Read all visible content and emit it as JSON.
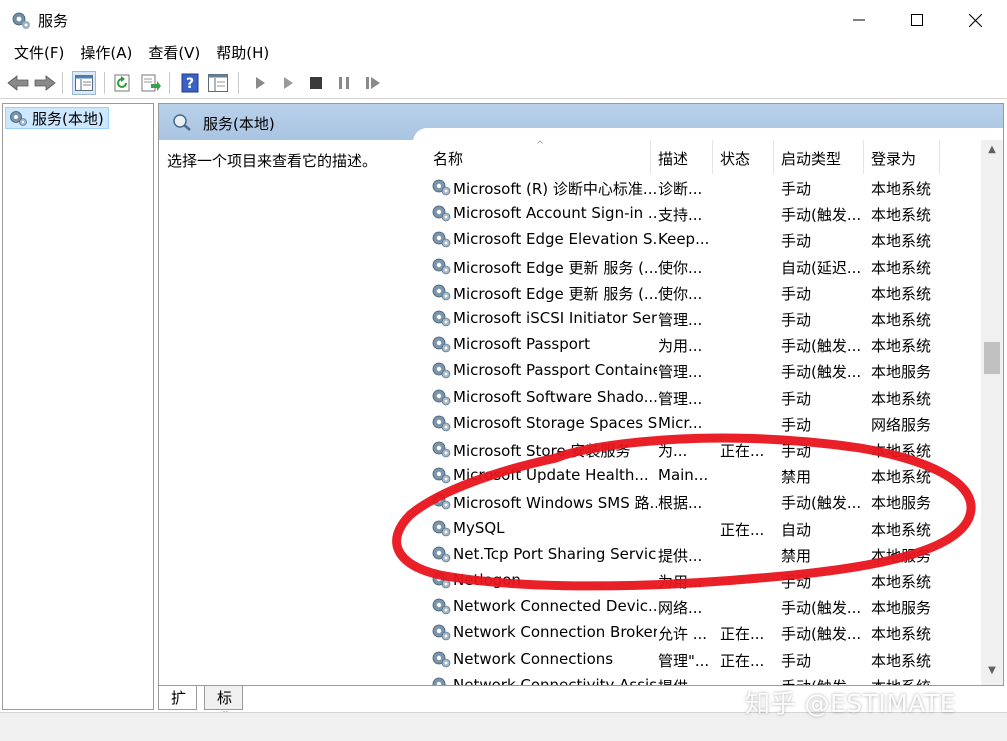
{
  "window": {
    "title": "服务"
  },
  "menu": [
    {
      "label": "文件(F)"
    },
    {
      "label": "操作(A)"
    },
    {
      "label": "查看(V)"
    },
    {
      "label": "帮助(H)"
    }
  ],
  "tree": {
    "root_label": "服务(本地)"
  },
  "pane": {
    "header_title": "服务(本地)",
    "description_hint": "选择一个项目来查看它的描述。"
  },
  "columns": {
    "name": "名称",
    "description": "描述",
    "status": "状态",
    "startup": "启动类型",
    "logon": "登录为"
  },
  "services": [
    {
      "name": "Microsoft (R) 诊断中心标准...",
      "description": "诊断...",
      "status": "",
      "startup": "手动",
      "logon": "本地系统"
    },
    {
      "name": "Microsoft Account Sign-in ...",
      "description": "支持...",
      "status": "",
      "startup": "手动(触发...",
      "logon": "本地系统"
    },
    {
      "name": "Microsoft Edge Elevation S...",
      "description": "Keep...",
      "status": "",
      "startup": "手动",
      "logon": "本地系统"
    },
    {
      "name": "Microsoft Edge 更新 服务 (...",
      "description": "使你...",
      "status": "",
      "startup": "自动(延迟...",
      "logon": "本地系统"
    },
    {
      "name": "Microsoft Edge 更新 服务 (...",
      "description": "使你...",
      "status": "",
      "startup": "手动",
      "logon": "本地系统"
    },
    {
      "name": "Microsoft iSCSI Initiator Ser...",
      "description": "管理...",
      "status": "",
      "startup": "手动",
      "logon": "本地系统"
    },
    {
      "name": "Microsoft Passport",
      "description": "为用...",
      "status": "",
      "startup": "手动(触发...",
      "logon": "本地系统"
    },
    {
      "name": "Microsoft Passport Container",
      "description": "管理...",
      "status": "",
      "startup": "手动(触发...",
      "logon": "本地服务"
    },
    {
      "name": "Microsoft Software Shado...",
      "description": "管理...",
      "status": "",
      "startup": "手动",
      "logon": "本地系统"
    },
    {
      "name": "Microsoft Storage Spaces S...",
      "description": "Micr...",
      "status": "",
      "startup": "手动",
      "logon": "网络服务"
    },
    {
      "name": "Microsoft Store 安装服务",
      "description": "为...",
      "status": "正在...",
      "startup": "手动",
      "logon": "本地系统"
    },
    {
      "name": "Microsoft Update Health...",
      "description": "Main...",
      "status": "",
      "startup": "禁用",
      "logon": "本地系统"
    },
    {
      "name": "Microsoft Windows SMS 路...",
      "description": "根据...",
      "status": "",
      "startup": "手动(触发...",
      "logon": "本地服务"
    },
    {
      "name": "MySQL",
      "description": "",
      "status": "正在...",
      "startup": "自动",
      "logon": "本地系统"
    },
    {
      "name": "Net.Tcp Port Sharing Service",
      "description": "提供...",
      "status": "",
      "startup": "禁用",
      "logon": "本地服务"
    },
    {
      "name": "Netlogon",
      "description": "为用...",
      "status": "",
      "startup": "手动",
      "logon": "本地系统"
    },
    {
      "name": "Network Connected Devic...",
      "description": "网络...",
      "status": "",
      "startup": "手动(触发...",
      "logon": "本地服务"
    },
    {
      "name": "Network Connection Broker",
      "description": "允许 ...",
      "status": "正在...",
      "startup": "手动(触发...",
      "logon": "本地系统"
    },
    {
      "name": "Network Connections",
      "description": "管理\"...",
      "status": "正在...",
      "startup": "手动",
      "logon": "本地系统"
    },
    {
      "name": "Network Connectivity Assis...",
      "description": "提供...",
      "status": "",
      "startup": "手动(触发...",
      "logon": "本地系统"
    }
  ],
  "tabs": [
    {
      "label": "扩展"
    },
    {
      "label": "标准"
    }
  ],
  "watermark": "知乎 @ESTIMATE",
  "colors": {
    "annotation": "#e8141c",
    "header_band": "#b9d1ea",
    "selection": "#cce8ff"
  }
}
